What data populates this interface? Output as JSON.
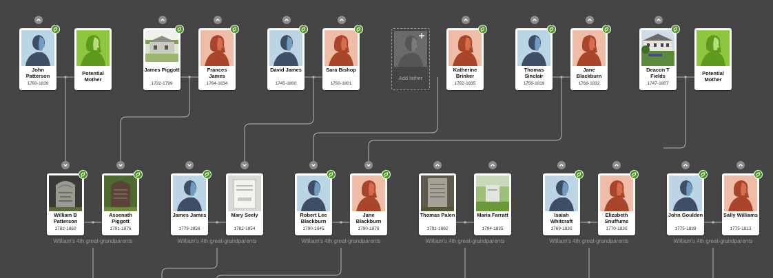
{
  "cards": [
    {
      "id": "c1",
      "name": "John Patterson",
      "dates": "1760-1839",
      "photo": "male-silhouette",
      "badge": true
    },
    {
      "id": "c2",
      "name": "Potential Mother",
      "dates": "",
      "photo": "female-silhouette-green",
      "badge": false
    },
    {
      "id": "c3",
      "name": "James Piggott",
      "dates": "1732-1799",
      "photo": "house-photo",
      "badge": true
    },
    {
      "id": "c4",
      "name": "Frances James",
      "dates": "1764-1834",
      "photo": "female-silhouette",
      "badge": true
    },
    {
      "id": "c5",
      "name": "David James",
      "dates": "1745-1800",
      "photo": "male-silhouette",
      "badge": true
    },
    {
      "id": "c6",
      "name": "Sara Bishop",
      "dates": "1750-1801",
      "photo": "female-silhouette",
      "badge": true
    },
    {
      "id": "c7",
      "name": "Katherine Brinker",
      "dates": "1762-1835",
      "photo": "female-silhouette",
      "badge": true
    },
    {
      "id": "c8",
      "name": "Thomas Sinclair",
      "dates": "1756-1818",
      "photo": "male-silhouette",
      "badge": true
    },
    {
      "id": "c9",
      "name": "Jane Blackburn",
      "dates": "1768-1832",
      "photo": "female-silhouette",
      "badge": true
    },
    {
      "id": "c10",
      "name": "Deacon T Fields",
      "dates": "1747-1807",
      "photo": "farmhouse-photo",
      "badge": true
    },
    {
      "id": "c11",
      "name": "Potential Mother",
      "dates": "",
      "photo": "female-silhouette-green",
      "badge": false
    },
    {
      "id": "c12",
      "name": "William B Patterson",
      "dates": "1782-1860",
      "photo": "gravestone-photo",
      "badge": true
    },
    {
      "id": "c13",
      "name": "Assenath Piggott",
      "dates": "1791-1876",
      "photo": "gravestone-dark-photo",
      "badge": true
    },
    {
      "id": "c14",
      "name": "James James",
      "dates": "1779-1858",
      "photo": "male-silhouette",
      "badge": true
    },
    {
      "id": "c15",
      "name": "Mary Seely",
      "dates": "1782-1854",
      "photo": "gravestone-white-photo",
      "badge": false
    },
    {
      "id": "c16",
      "name": "Robert Lee Blackburn",
      "dates": "1790-1845",
      "photo": "male-silhouette",
      "badge": true
    },
    {
      "id": "c17",
      "name": "Jane Blackburn",
      "dates": "1790-1878",
      "photo": "female-silhouette",
      "badge": true
    },
    {
      "id": "c18",
      "name": "Thomas Palen",
      "dates": "1791-1862",
      "photo": "gravestone-photo",
      "badge": false
    },
    {
      "id": "c19",
      "name": "Maria Farratt",
      "dates": "1794-1835",
      "photo": "gravestone-grass-photo",
      "badge": false
    },
    {
      "id": "c20",
      "name": "Isaiah Whitcraft",
      "dates": "1769-1830",
      "photo": "male-silhouette",
      "badge": true
    },
    {
      "id": "c21",
      "name": "Elizabeth Snuffums",
      "dates": "1770-1830",
      "photo": "female-silhouette",
      "badge": true
    },
    {
      "id": "c22",
      "name": "John Goulden",
      "dates": "1775-1839",
      "photo": "male-silhouette",
      "badge": true
    },
    {
      "id": "c23",
      "name": "Sally Williams",
      "dates": "1775-1813",
      "photo": "female-silhouette",
      "badge": true
    }
  ],
  "add_father": {
    "label": "Add father"
  },
  "captions": [
    "William's 4th great-grandparents",
    "William's 4th great-grandparents",
    "William's 4th great-grandparents",
    "William's 4th great-grandparents",
    "William's 4th great-grandparents",
    "William's 4th great-grandparents"
  ],
  "colors": {
    "background": "#454545",
    "male_bg": "#bcd5e4",
    "male_figure": "#3f4e66",
    "male_face": "#6f9cc0",
    "female_bg": "#efbca7",
    "female_figure": "#a8452a",
    "female_face": "#d76d4c",
    "potential_bg": "#8ec63f",
    "potential_figure": "#5e9a1c",
    "badge": "#4a9a1c",
    "connector": "#b8b8b8"
  }
}
